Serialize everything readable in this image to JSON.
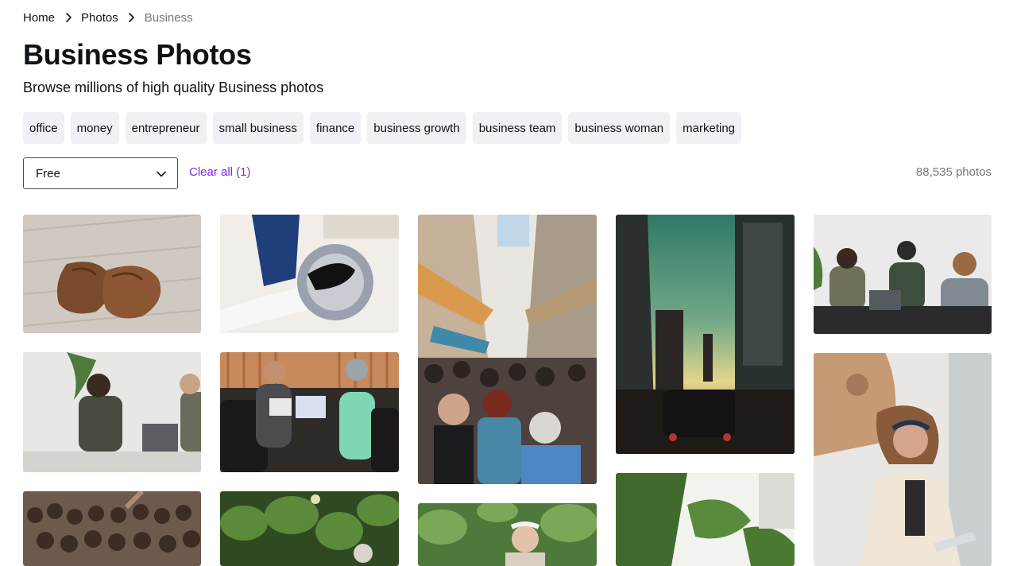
{
  "breadcrumb": {
    "items": [
      "Home",
      "Photos",
      "Business"
    ]
  },
  "page": {
    "title": "Business Photos",
    "subtitle": "Browse millions of high quality Business photos"
  },
  "tags": [
    "office",
    "money",
    "entrepreneur",
    "small business",
    "finance",
    "business growth",
    "business team",
    "business woman",
    "marketing"
  ],
  "filters": {
    "license_selected": "Free",
    "clear_label": "Clear all (1)",
    "result_count": "88,535 photos"
  },
  "photos": [
    {
      "subject": "brown leather shoes on wooden floor"
    },
    {
      "subject": "person polishing black shoe"
    },
    {
      "subject": "crowded market street"
    },
    {
      "subject": "city skyline at sunset"
    },
    {
      "subject": "three colleagues at laptops"
    },
    {
      "subject": "two men working on laptops"
    },
    {
      "subject": "business meeting at desk"
    },
    {
      "subject": "woman writing at desk"
    },
    {
      "subject": "concert crowd"
    },
    {
      "subject": "man among plants in greenhouse"
    },
    {
      "subject": "older man in greenhouse"
    },
    {
      "subject": "green leaves close-up"
    }
  ]
}
